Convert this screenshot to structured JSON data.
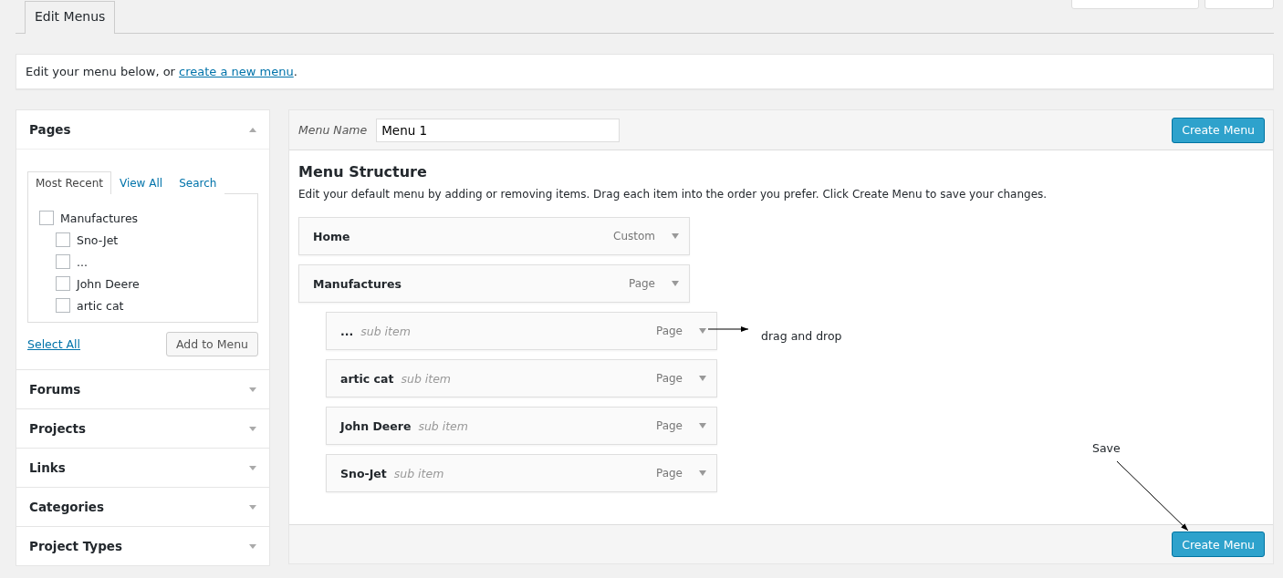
{
  "tabs": [
    {
      "label": "Edit Menus",
      "selected": true
    }
  ],
  "notice": {
    "text": "Edit your menu below, or ",
    "link": "create a new menu",
    "after": "."
  },
  "sidebar": [
    {
      "title": "Pages",
      "expanded": true,
      "tabs": [
        {
          "label": "Most Recent",
          "selected": true
        },
        {
          "label": "View All",
          "selected": false
        },
        {
          "label": "Search",
          "selected": false
        }
      ],
      "items": [
        {
          "label": "Manufactures",
          "checked": false,
          "children": [
            {
              "label": "Sno-Jet",
              "checked": false
            },
            {
              "label": "...",
              "checked": false
            },
            {
              "label": "John Deere",
              "checked": false
            },
            {
              "label": "artic cat",
              "checked": false
            }
          ]
        }
      ],
      "select_all": "Select All",
      "add_button": "Add to Menu"
    },
    {
      "title": "Forums",
      "expanded": false
    },
    {
      "title": "Projects",
      "expanded": false
    },
    {
      "title": "Links",
      "expanded": false
    },
    {
      "title": "Categories",
      "expanded": false
    },
    {
      "title": "Project Types",
      "expanded": false
    }
  ],
  "menu": {
    "name_label": "Menu Name",
    "name_value": "Menu 1",
    "create_button": "Create Menu",
    "structure_title": "Menu Structure",
    "structure_hint": "Edit your default menu by adding or removing items. Drag each item into the order you prefer. Click Create Menu to save your changes.",
    "items": [
      {
        "label": "Home",
        "type": "Custom"
      },
      {
        "label": "Manufactures",
        "type": "Page",
        "children": [
          {
            "label": "...",
            "note": "sub item",
            "type": "Page"
          },
          {
            "label": "artic cat",
            "note": "sub item",
            "type": "Page"
          },
          {
            "label": "John Deere",
            "note": "sub item",
            "type": "Page"
          },
          {
            "label": "Sno-Jet",
            "note": "sub item",
            "type": "Page"
          }
        ]
      }
    ],
    "footer_button": "Create Menu"
  },
  "annotations": [
    {
      "kind": "horizontal",
      "text": "drag and drop"
    },
    {
      "kind": "diagonal",
      "text": "Save"
    }
  ]
}
